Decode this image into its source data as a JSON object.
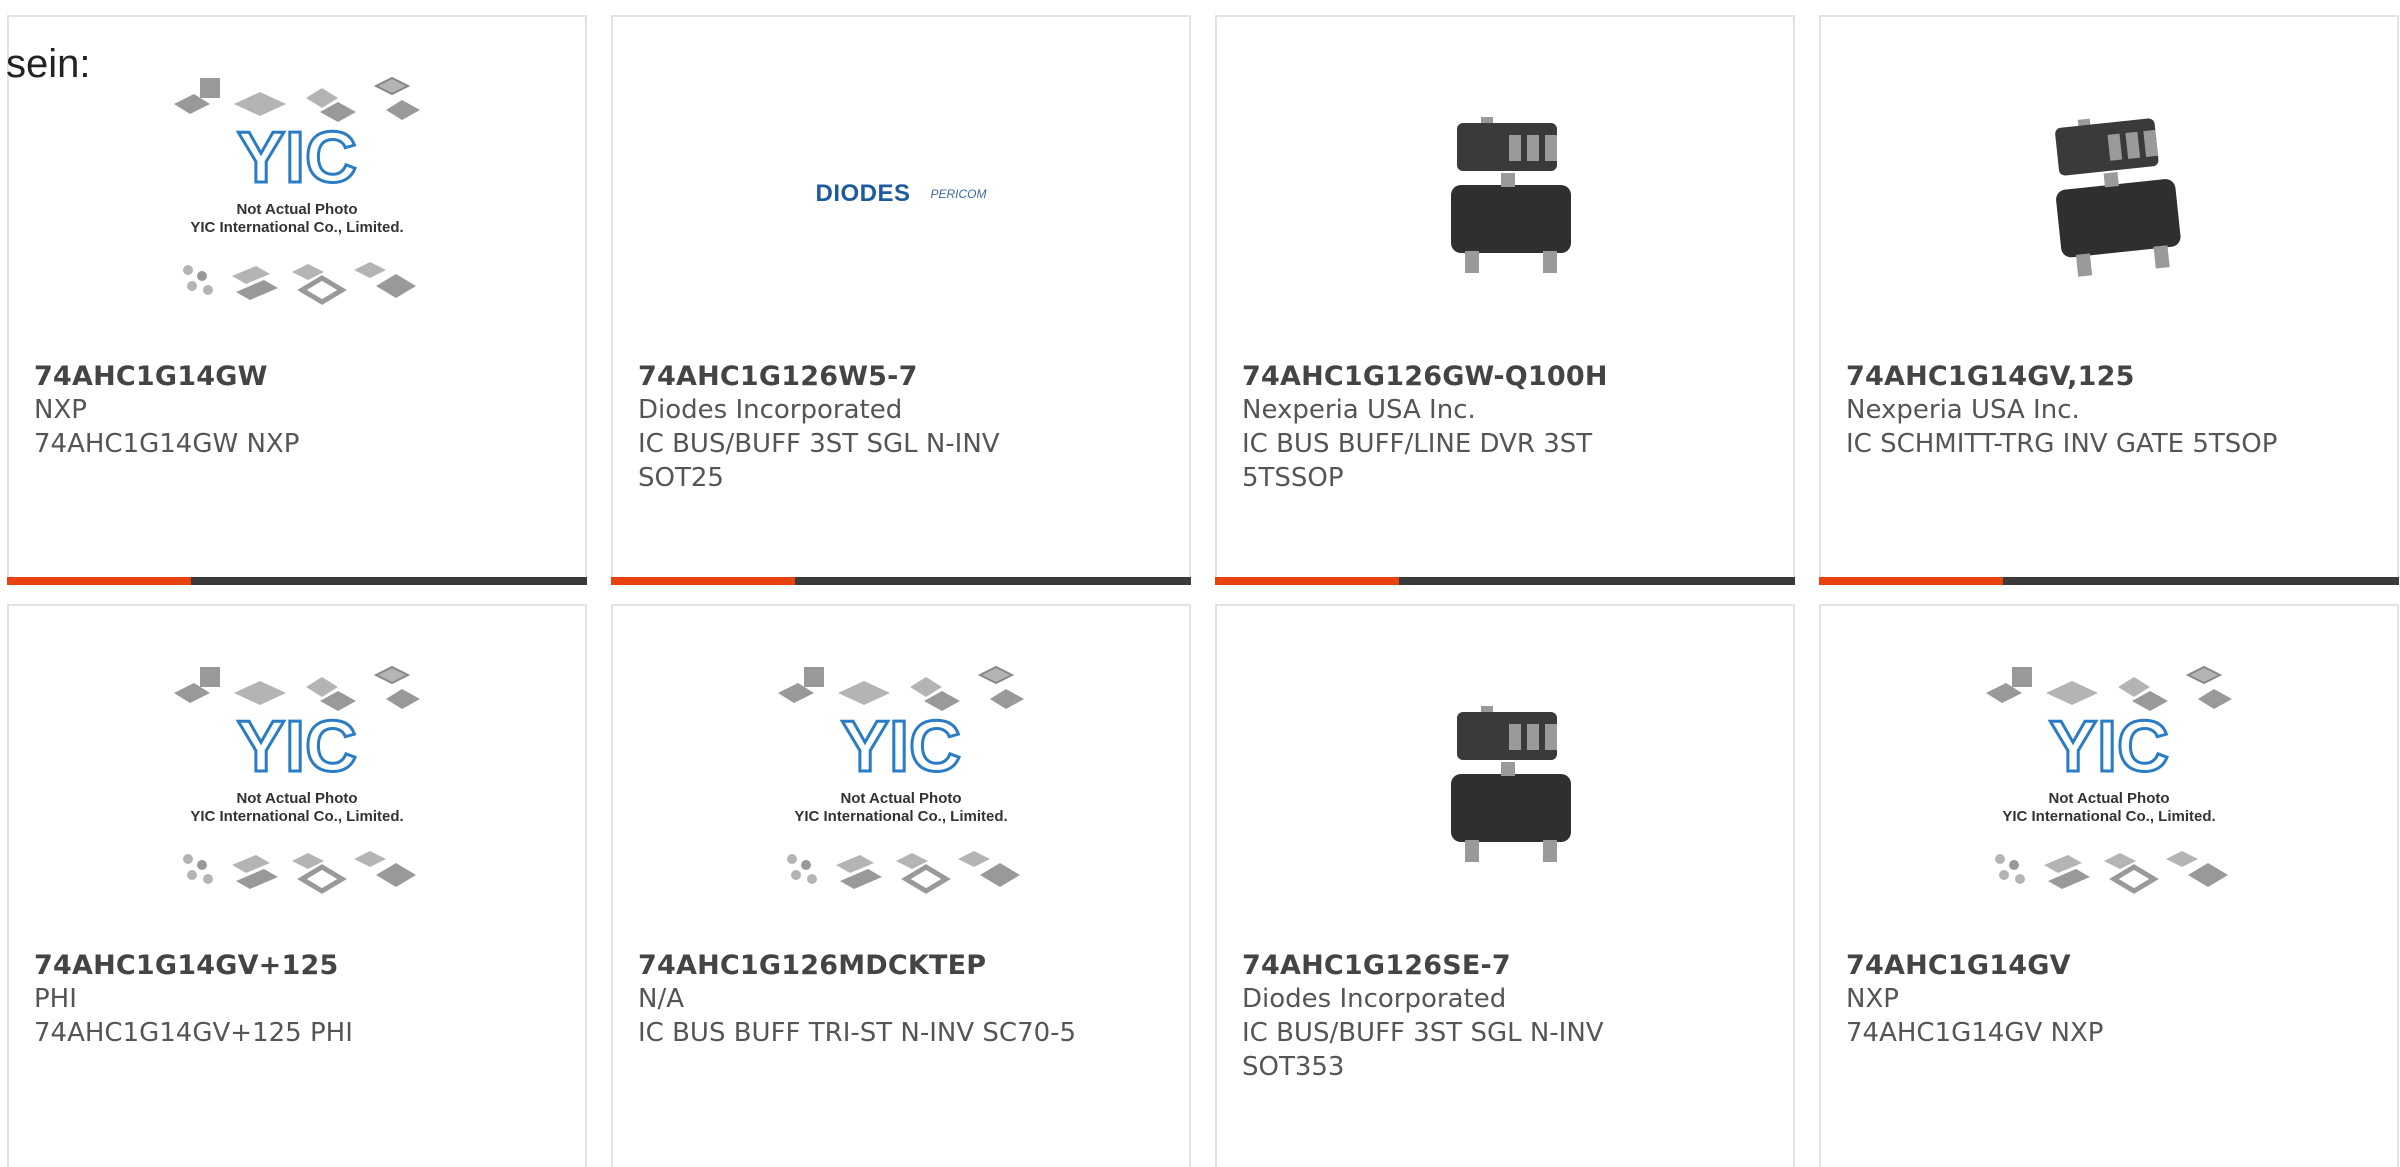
{
  "lead_text": "sein:",
  "placeholder": {
    "caption_line1": "Not Actual Photo",
    "caption_line2": "YIC International Co., Limited.",
    "logo_text": "YIC"
  },
  "diodes_logo": {
    "main": "DIODES",
    "sub": "PERICOM"
  },
  "colors": {
    "accent": "#e8420e",
    "bar": "#3a3a3a",
    "card_border": "#e2e2e2",
    "chip": "#3a3a3a",
    "yic_blue": "#2a7cc4"
  },
  "products": [
    {
      "part_number": "74AHC1G14GW",
      "manufacturer": "NXP",
      "description": "74AHC1G14GW NXP",
      "image": "yic-placeholder-icon"
    },
    {
      "part_number": "74AHC1G126W5-7",
      "manufacturer": "Diodes Incorporated",
      "description": "IC BUS/BUFF 3ST SGL N-INV SOT25",
      "image": "diodes-logo-icon"
    },
    {
      "part_number": "74AHC1G126GW-Q100H",
      "manufacturer": "Nexperia USA Inc.",
      "description": "IC BUS BUFF/LINE DVR 3ST 5TSSOP",
      "image": "sot-chip-icon"
    },
    {
      "part_number": "74AHC1G14GV,125",
      "manufacturer": "Nexperia USA Inc.",
      "description": "IC SCHMITT-TRG INV GATE 5TSOP",
      "image": "sot-chip-icon"
    },
    {
      "part_number": "74AHC1G14GV+125",
      "manufacturer": "PHI",
      "description": "74AHC1G14GV+125 PHI",
      "image": "yic-placeholder-icon"
    },
    {
      "part_number": "74AHC1G126MDCKTEP",
      "manufacturer": "N/A",
      "description": "IC BUS BUFF TRI-ST N-INV SC70-5",
      "image": "yic-placeholder-icon"
    },
    {
      "part_number": "74AHC1G126SE-7",
      "manufacturer": "Diodes Incorporated",
      "description": "IC BUS/BUFF 3ST SGL N-INV SOT353",
      "image": "sot-chip-icon"
    },
    {
      "part_number": "74AHC1G14GV",
      "manufacturer": "NXP",
      "description": "74AHC1G14GV NXP",
      "image": "yic-placeholder-icon"
    }
  ]
}
